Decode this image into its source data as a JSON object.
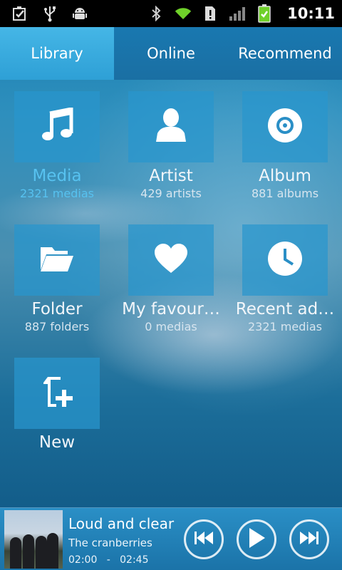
{
  "status_bar": {
    "time": "10:11",
    "icons": [
      "checklist-icon",
      "usb-icon",
      "android-debug-icon",
      "bluetooth-icon",
      "wifi-icon",
      "alert-icon",
      "signal-icon",
      "battery-charging-icon"
    ]
  },
  "tabs": [
    {
      "label": "Library",
      "active": true
    },
    {
      "label": "Online",
      "active": false
    },
    {
      "label": "Recommend",
      "active": false
    }
  ],
  "library": {
    "items": [
      {
        "title": "Media",
        "subtitle": "2321 medias",
        "icon": "music-note-icon"
      },
      {
        "title": "Artist",
        "subtitle": "429 artists",
        "icon": "person-icon"
      },
      {
        "title": "Album",
        "subtitle": "881 albums",
        "icon": "disc-icon"
      },
      {
        "title": "Folder",
        "subtitle": "887 folders",
        "icon": "folder-icon"
      },
      {
        "title": "My favour…",
        "subtitle": "0 medias",
        "icon": "heart-icon"
      },
      {
        "title": "Recent ad…",
        "subtitle": "2321 medias",
        "icon": "clock-icon"
      },
      {
        "title": "New",
        "subtitle": "",
        "icon": "new-file-icon"
      }
    ]
  },
  "player": {
    "title": "Loud and clear",
    "artist": "The cranberries",
    "time_current": "02:00",
    "time_separator": "-",
    "time_total": "02:45",
    "controls": [
      "previous-icon",
      "play-icon",
      "next-icon"
    ]
  }
}
